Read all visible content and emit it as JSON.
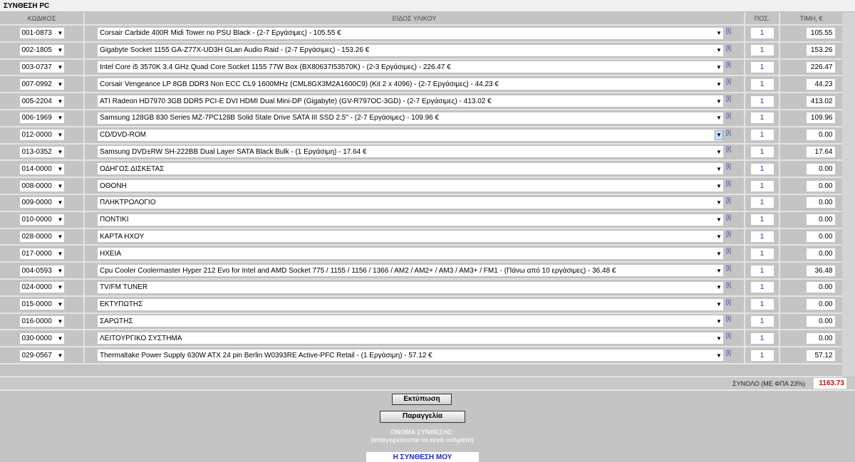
{
  "title": "ΣΥΝΘΕΣΗ PC",
  "headers": {
    "code": "ΚΩΔΙΚΟΣ",
    "item": "ΕΙΔΟΣ ΥΛΙΚΟΥ",
    "qty": "ΠΟΣ.",
    "price": "ΤΙΜΗ, €"
  },
  "info_label": "[i]",
  "rows": [
    {
      "code": "001-0873",
      "item": "Corsair Carbide 400R Midi Tower no PSU Black - (2-7 Εργάσιμες) - 105.55 €",
      "qty": "1",
      "price": "105.55"
    },
    {
      "code": "002-1805",
      "item": "Gigabyte Socket 1155 GA-Z77X-UD3H GLan Audio Raid - (2-7 Εργάσιμες) - 153.26 €",
      "qty": "1",
      "price": "153.26"
    },
    {
      "code": "003-0737",
      "item": "Intel Core i5 3570K 3.4 GHz Quad Core Socket 1155 77W Box (BX80637I53570K) - (2-3 Εργάσιμες) - 226.47 €",
      "qty": "1",
      "price": "226.47"
    },
    {
      "code": "007-0992",
      "item": "Corsair Vengeance LP 8GB DDR3 Non ECC CL9 1600MHz (CML8GX3M2A1600C9) (Kit 2 x 4096) - (2-7 Εργάσιμες) - 44.23 €",
      "qty": "1",
      "price": "44.23"
    },
    {
      "code": "005-2204",
      "item": "ATI Radeon HD7970 3GB DDR5 PCI-E DVI HDMI Dual Mini-DP (Gigabyte) (GV-R797OC-3GD) - (2-7 Εργάσιμες) - 413.02 €",
      "qty": "1",
      "price": "413.02"
    },
    {
      "code": "006-1969",
      "item": "Samsung 128GB 830 Series MZ-7PC128B Solid State Drive SATA III SSD 2.5\" - (2-7 Εργάσιμες) - 109.96 €",
      "qty": "1",
      "price": "109.96"
    },
    {
      "code": "012-0000",
      "item": "CD/DVD-ROM",
      "qty": "1",
      "price": "0.00",
      "focused": true
    },
    {
      "code": "013-0352",
      "item": "Samsung DVD±RW SH-222BB Dual Layer SATA Black Bulk - (1 Εργάσιμη) - 17.64 €",
      "qty": "1",
      "price": "17.64"
    },
    {
      "code": "014-0000",
      "item": "ΟΔΗΓΟΣ ΔΙΣΚΕΤΑΣ",
      "qty": "1",
      "price": "0.00"
    },
    {
      "code": "008-0000",
      "item": "ΟΘΟΝΗ",
      "qty": "1",
      "price": "0.00"
    },
    {
      "code": "009-0000",
      "item": "ΠΛΗΚΤΡΟΛΟΓΙΟ",
      "qty": "1",
      "price": "0.00"
    },
    {
      "code": "010-0000",
      "item": "ΠΟΝΤΙΚΙ",
      "qty": "1",
      "price": "0.00"
    },
    {
      "code": "028-0000",
      "item": "ΚΑΡΤΑ ΗΧΟΥ",
      "qty": "1",
      "price": "0.00"
    },
    {
      "code": "017-0000",
      "item": "ΗΧΕΙΑ",
      "qty": "1",
      "price": "0.00"
    },
    {
      "code": "004-0593",
      "item": "Cpu Cooler Coolermaster Hyper 212 Evo for Intel and AMD Socket 775 / 1155 / 1156 / 1366 / AM2 / AM2+ / AM3 / AM3+ / FM1 - (Πάνω από 10 εργάσιμες) - 36.48 €",
      "qty": "1",
      "price": "36.48"
    },
    {
      "code": "024-0000",
      "item": "TV/FM TUNER",
      "qty": "1",
      "price": "0.00"
    },
    {
      "code": "015-0000",
      "item": "ΕΚΤΥΠΩΤΗΣ",
      "qty": "1",
      "price": "0.00"
    },
    {
      "code": "016-0000",
      "item": "ΣΑΡΩΤΗΣ",
      "qty": "1",
      "price": "0.00"
    },
    {
      "code": "030-0000",
      "item": "ΛΕΙΤΟΥΡΓΙΚΟ ΣΥΣΤΗΜΑ",
      "qty": "1",
      "price": "0.00"
    },
    {
      "code": "029-0567",
      "item": "Thermaltake Power Supply 630W ATX 24 pin Berlin W0393RE Active-PFC Retail - (1 Εργάσιμη) - 57.12 €",
      "qty": "1",
      "price": "57.12"
    }
  ],
  "total": {
    "label": "ΣΥΝΟΛΟ (ΜΕ ΦΠΑ 23%)",
    "value": "1163.73"
  },
  "buttons": {
    "print": "Εκτύπωση",
    "order": "Παραγγελία"
  },
  "name_label": "ΟΝΟΜΑ ΣΥΝΘΕΣΗΣ:",
  "name_hint": "(απαγορεύονται τα κενά ονόματα)",
  "name_value": "Η ΣΥΝΘΕΣΗ ΜΟΥ"
}
